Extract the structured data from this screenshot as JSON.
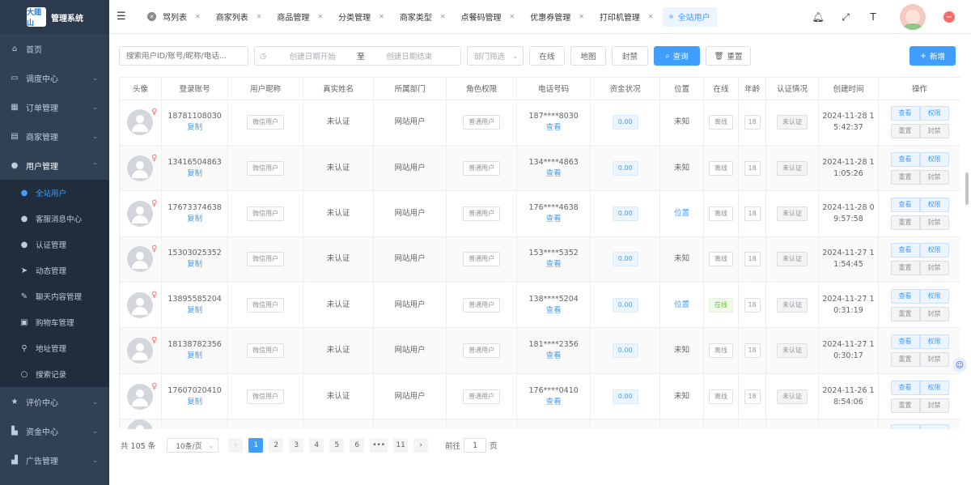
{
  "brand": {
    "badge": "大翅山",
    "title": "管理系统"
  },
  "sidebar": {
    "top_items": [
      {
        "label": "首页",
        "icon": "home-icon"
      },
      {
        "label": "调度中心",
        "icon": "monitor-icon"
      },
      {
        "label": "订单管理",
        "icon": "grid-icon"
      },
      {
        "label": "商家管理",
        "icon": "shop-icon"
      },
      {
        "label": "用户管理",
        "icon": "user-icon"
      }
    ],
    "sub_items": [
      {
        "label": "全站用户",
        "icon": "user-icon"
      },
      {
        "label": "客服消息中心",
        "icon": "user-icon"
      },
      {
        "label": "认证管理",
        "icon": "user-icon"
      },
      {
        "label": "动态管理",
        "icon": "send-icon"
      },
      {
        "label": "聊天内容管理",
        "icon": "chat-icon"
      },
      {
        "label": "购物车管理",
        "icon": "cart-icon"
      },
      {
        "label": "地址管理",
        "icon": "location-icon"
      },
      {
        "label": "搜索记录",
        "icon": "search-icon"
      }
    ],
    "bottom_items": [
      {
        "label": "评价中心",
        "icon": "star-icon"
      },
      {
        "label": "资金中心",
        "icon": "wallet-icon"
      },
      {
        "label": "广告管理",
        "icon": "ad-icon"
      }
    ]
  },
  "tabs": [
    "骂列表",
    "商家列表",
    "商品管理",
    "分类管理",
    "商家类型",
    "点餐码管理",
    "优惠券管理",
    "打印机管理",
    "全站用户"
  ],
  "filters": {
    "search_placeholder": "搜索用户ID/账号/昵称/电话...",
    "date_start": "创建日期开始",
    "date_sep": "至",
    "date_end": "创建日期结束",
    "dept_placeholder": "部门筛选",
    "btn_online": "在线",
    "btn_map": "地图",
    "btn_ban": "封禁",
    "btn_query": "查询",
    "btn_reset": "重置",
    "btn_add": "新增"
  },
  "table": {
    "headers": [
      "头像",
      "登录账号",
      "用户昵称",
      "真实姓名",
      "所属部门",
      "角色权限",
      "电话号码",
      "资金状况",
      "位置",
      "在线",
      "年龄",
      "认证情况",
      "创建时间",
      "操作"
    ],
    "copy_label": "复制",
    "view_label": "查看",
    "op_labels": [
      "查看",
      "权限",
      "重置",
      "封禁"
    ],
    "rows": [
      {
        "account": "18781108030",
        "nickname": "微信用户",
        "realname": "未认证",
        "dept": "网站用户",
        "role": "普通用户",
        "phone": "187****8030",
        "money": "0.00",
        "location": "未知",
        "online": "离线",
        "age": "18",
        "auth": "未认证",
        "created_1": "2024-11-28 1",
        "created_2": "5:42:37"
      },
      {
        "account": "13416504863",
        "nickname": "微信用户",
        "realname": "未认证",
        "dept": "网站用户",
        "role": "普通用户",
        "phone": "134****4863",
        "money": "0.00",
        "location": "未知",
        "online": "离线",
        "age": "18",
        "auth": "未认证",
        "created_1": "2024-11-28 1",
        "created_2": "1:05:26"
      },
      {
        "account": "17673374638",
        "nickname": "微信用户",
        "realname": "未认证",
        "dept": "网站用户",
        "role": "普通用户",
        "phone": "176****4638",
        "money": "0.00",
        "location": "位置",
        "online": "离线",
        "age": "18",
        "auth": "未认证",
        "created_1": "2024-11-28 0",
        "created_2": "9:57:58"
      },
      {
        "account": "15303025352",
        "nickname": "微信用户",
        "realname": "未认证",
        "dept": "网站用户",
        "role": "普通用户",
        "phone": "153****5352",
        "money": "0.00",
        "location": "未知",
        "online": "离线",
        "age": "18",
        "auth": "未认证",
        "created_1": "2024-11-27 1",
        "created_2": "1:54:45"
      },
      {
        "account": "13895585204",
        "nickname": "微信用户",
        "realname": "未认证",
        "dept": "网站用户",
        "role": "普通用户",
        "phone": "138****5204",
        "money": "0.00",
        "location": "位置",
        "online": "在线",
        "age": "18",
        "auth": "未认证",
        "created_1": "2024-11-27 1",
        "created_2": "0:31:19"
      },
      {
        "account": "18138782356",
        "nickname": "微信用户",
        "realname": "未认证",
        "dept": "网站用户",
        "role": "普通用户",
        "phone": "181****2356",
        "money": "0.00",
        "location": "未知",
        "online": "离线",
        "age": "18",
        "auth": "未认证",
        "created_1": "2024-11-27 1",
        "created_2": "0:30:17"
      },
      {
        "account": "17607020410",
        "nickname": "微信用户",
        "realname": "未认证",
        "dept": "网站用户",
        "role": "普通用户",
        "phone": "176****0410",
        "money": "0.00",
        "location": "未知",
        "online": "离线",
        "age": "18",
        "auth": "未认证",
        "created_1": "2024-11-26 1",
        "created_2": "8:54:06"
      }
    ]
  },
  "pager": {
    "total": "共 105 条",
    "page_size": "10条/页",
    "pages": [
      "1",
      "2",
      "3",
      "4",
      "5",
      "6",
      "•••",
      "11"
    ],
    "goto_prefix": "前往",
    "goto_value": "1",
    "goto_suffix": "页"
  }
}
